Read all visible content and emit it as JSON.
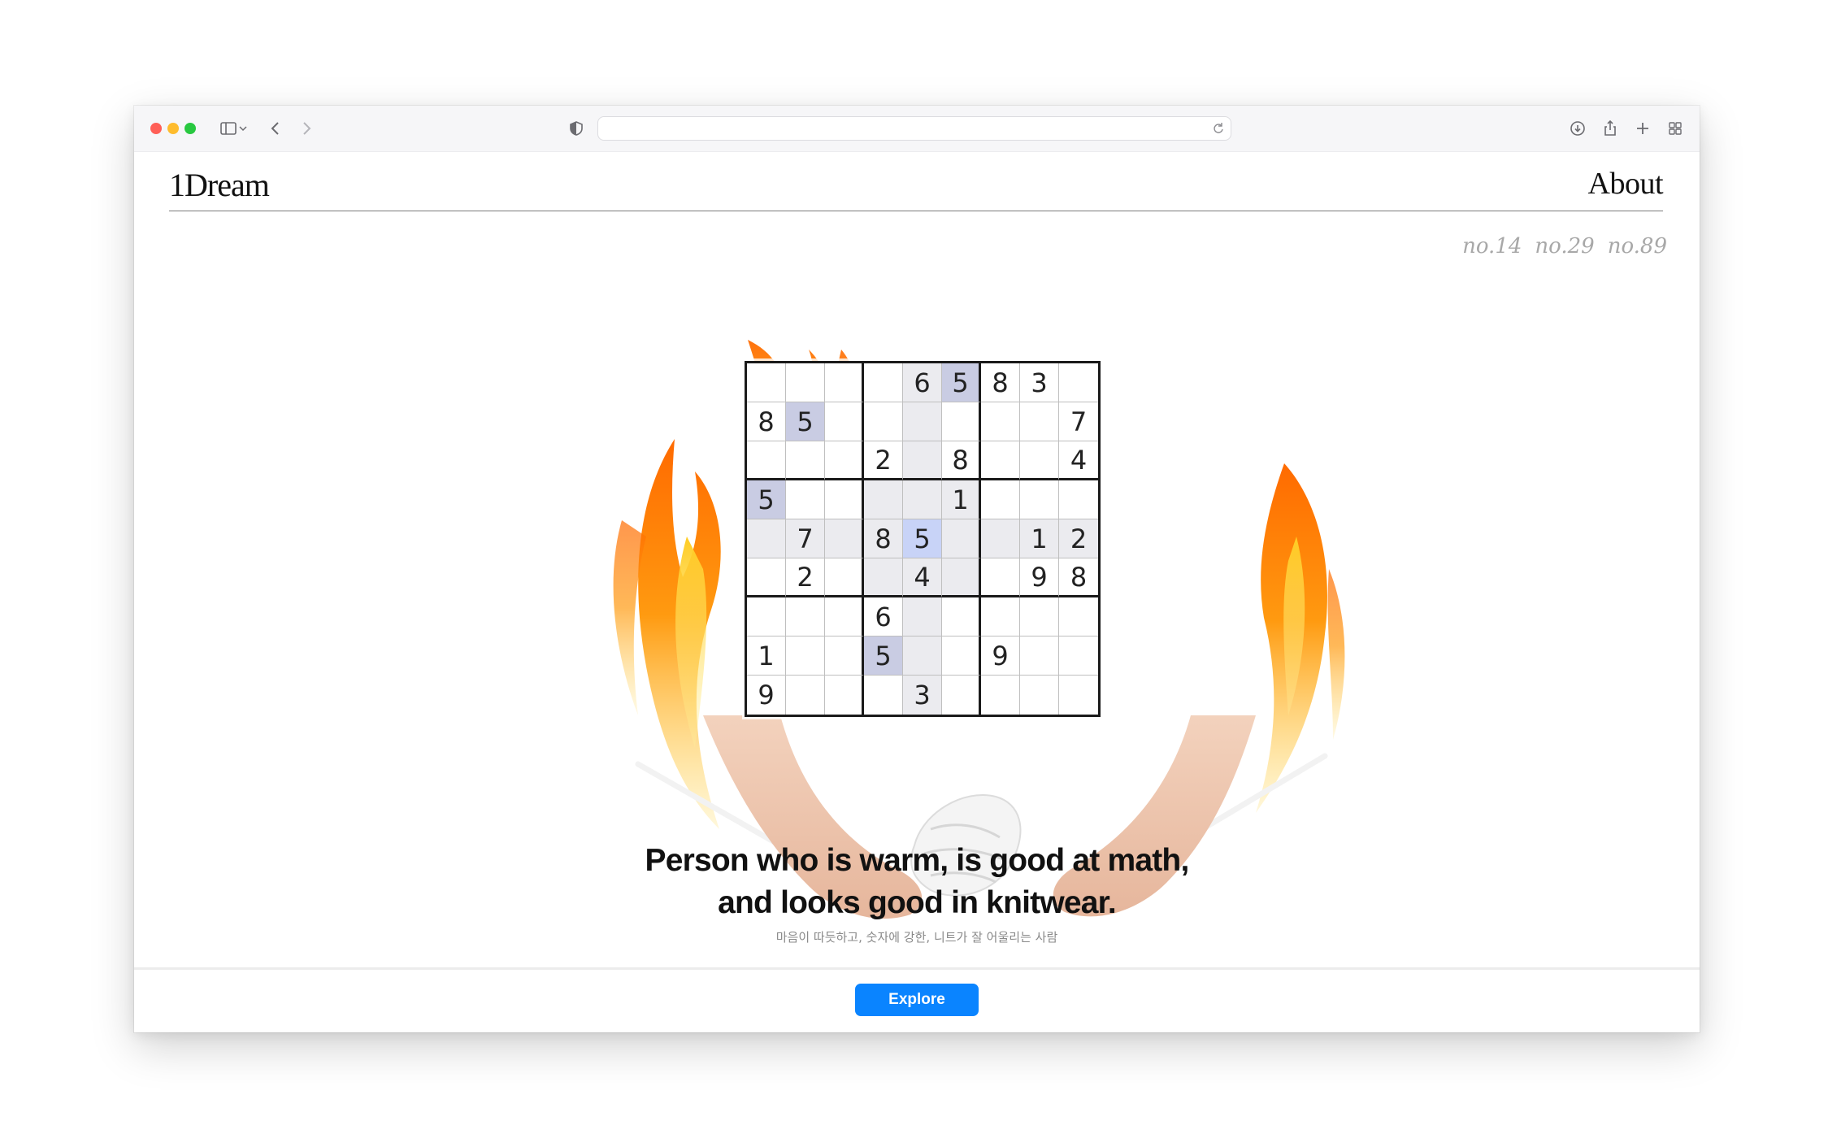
{
  "browser": {
    "traffic_lights": [
      "close",
      "minimize",
      "zoom"
    ],
    "address": "",
    "icons": [
      "sidebar-icon",
      "chevron-down-icon",
      "back-icon",
      "forward-icon",
      "shield-icon",
      "reload-icon",
      "download-icon",
      "share-icon",
      "new-tab-icon",
      "tab-overview-icon"
    ]
  },
  "site": {
    "logo": "1Dream",
    "nav_about": "About",
    "issue_links": [
      "no.14",
      "no.29",
      "no.89"
    ]
  },
  "hero": {
    "headline_line1": "Person who is warm, is good at math,",
    "headline_line2": "and looks good in knitwear.",
    "subline": "마음이 따듯하고, 숫자에 강한, 니트가 잘 어울리는 사람"
  },
  "sudoku": {
    "rows": [
      [
        "",
        "",
        "",
        "",
        "6",
        "5",
        "8",
        "3",
        ""
      ],
      [
        "8",
        "5",
        "",
        "",
        "",
        "",
        "",
        "",
        "7"
      ],
      [
        "",
        "",
        "",
        "2",
        "",
        "8",
        "",
        "",
        "4"
      ],
      [
        "5",
        "",
        "",
        "",
        "",
        "1",
        "",
        "",
        ""
      ],
      [
        "",
        "7",
        "",
        "8",
        "5",
        "",
        "",
        "1",
        "2"
      ],
      [
        "",
        "2",
        "",
        "",
        "4",
        "",
        "",
        "9",
        "8"
      ],
      [
        "",
        "",
        "",
        "6",
        "",
        "",
        "",
        "",
        ""
      ],
      [
        "1",
        "",
        "",
        "5",
        "",
        "",
        "9",
        "",
        ""
      ],
      [
        "9",
        "",
        "",
        "",
        "3",
        "",
        "",
        "",
        ""
      ]
    ],
    "selected_value": "5"
  },
  "footer": {
    "explore_label": "Explore"
  },
  "colors": {
    "accent": "#0a84ff",
    "cell_highlight": "#ebebef",
    "cell_match": "#c9cce3",
    "cell_current": "#c8d3f7",
    "flame_outer": "#ff7a00",
    "flame_inner": "#ffd21a"
  }
}
